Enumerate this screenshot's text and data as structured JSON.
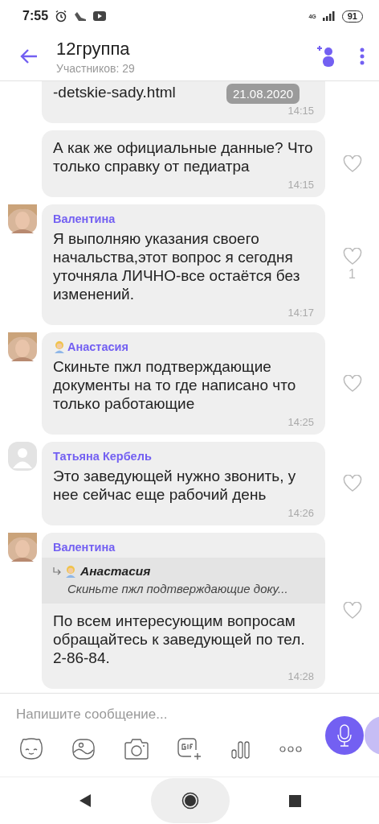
{
  "status_bar": {
    "time": "7:55",
    "network": "4G",
    "battery": "91"
  },
  "header": {
    "title": "12группа",
    "subtitle": "Участников: 29"
  },
  "date_chip": "21.08.2020",
  "messages": [
    {
      "kind": "followup",
      "text": "-detskie-sady.html",
      "time": "14:15",
      "cut_top": true
    },
    {
      "kind": "followup",
      "text": "А как же официальные данные? Что только справку от педиатра",
      "time": "14:15",
      "liked": false
    },
    {
      "sender": "Валентина",
      "sender_emoji": false,
      "text": "Я выполняю указания своего начальства,этот вопрос я сегодня уточняла ЛИЧНО-все остаётся без изменений.",
      "time": "14:17",
      "liked": false,
      "likes": "1"
    },
    {
      "sender": "Анастасия",
      "sender_emoji": true,
      "text": "Скиньте пжл подтверждающие документы на то где написано что только работающие",
      "time": "14:25",
      "liked": false
    },
    {
      "kind": "default",
      "sender": "Татьяна Кербель",
      "sender_emoji": false,
      "text": "Это заведующей нужно звонить, у нее сейчас еще рабочий день",
      "time": "14:26",
      "liked": false
    },
    {
      "sender": "Валентина",
      "sender_emoji": false,
      "reply": {
        "sender": "Анастасия",
        "sender_emoji": true,
        "text": "Скиньте пжл подтверждающие доку..."
      },
      "text": "По всем интересующим вопросам обращайтесь к заведующей по тел. 2-86-84.",
      "time": "14:28",
      "liked": false
    }
  ],
  "composer": {
    "placeholder": "Напишите сообщение..."
  }
}
